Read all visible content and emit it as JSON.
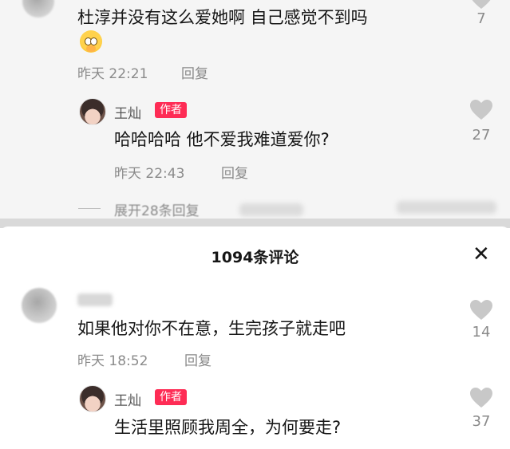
{
  "top": {
    "comment1": {
      "text": "杜淳并没有这么爱她啊 自己感觉不到吗",
      "emoji": "pleading-face",
      "time": "昨天 22:21",
      "reply": "回复",
      "likes": "7"
    },
    "reply1": {
      "author": "王灿",
      "badge": "作者",
      "text": "哈哈哈哈 他不爱我难道爱你?",
      "time": "昨天 22:43",
      "reply": "回复",
      "likes": "27"
    },
    "expand": "展开28条回复"
  },
  "sheet": {
    "title": "1094条评论",
    "close": "✕",
    "comment2": {
      "text": "如果他对你不在意，生完孩子就走吧",
      "time": "昨天 18:52",
      "reply": "回复",
      "likes": "14"
    },
    "reply2": {
      "author": "王灿",
      "badge": "作者",
      "text": "生活里照顾我周全，为何要走?",
      "likes": "37"
    }
  },
  "colors": {
    "badge": "#fe2c55",
    "meta": "#8a8a8a",
    "heart": "#c8c8c8"
  }
}
